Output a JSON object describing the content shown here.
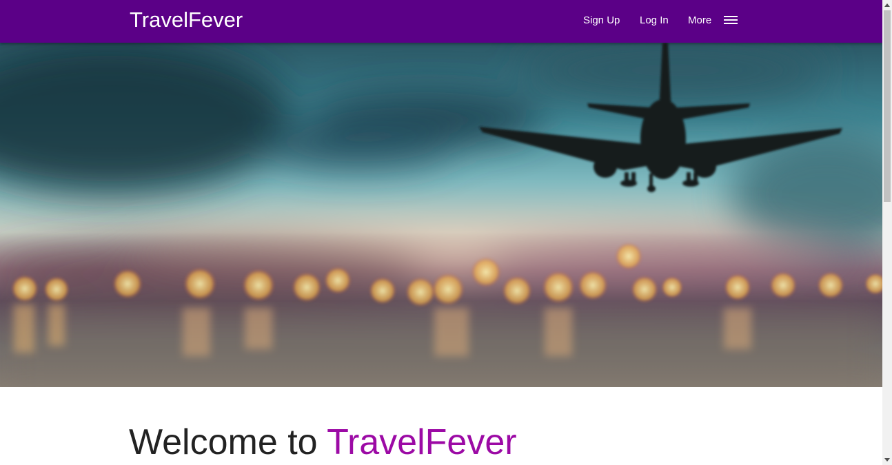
{
  "navbar": {
    "brand": "TravelFever",
    "items": [
      {
        "label": "Sign Up"
      },
      {
        "label": "Log In"
      },
      {
        "label": "More"
      }
    ],
    "menu_icon": "hamburger-menu-icon",
    "background_color": "#5b0087"
  },
  "hero": {
    "image": "blurred-airport-airplane-hero-image"
  },
  "welcome": {
    "prefix": "Welcome to",
    "brand": "TravelFever",
    "accent_color": "#9c0aa5"
  }
}
